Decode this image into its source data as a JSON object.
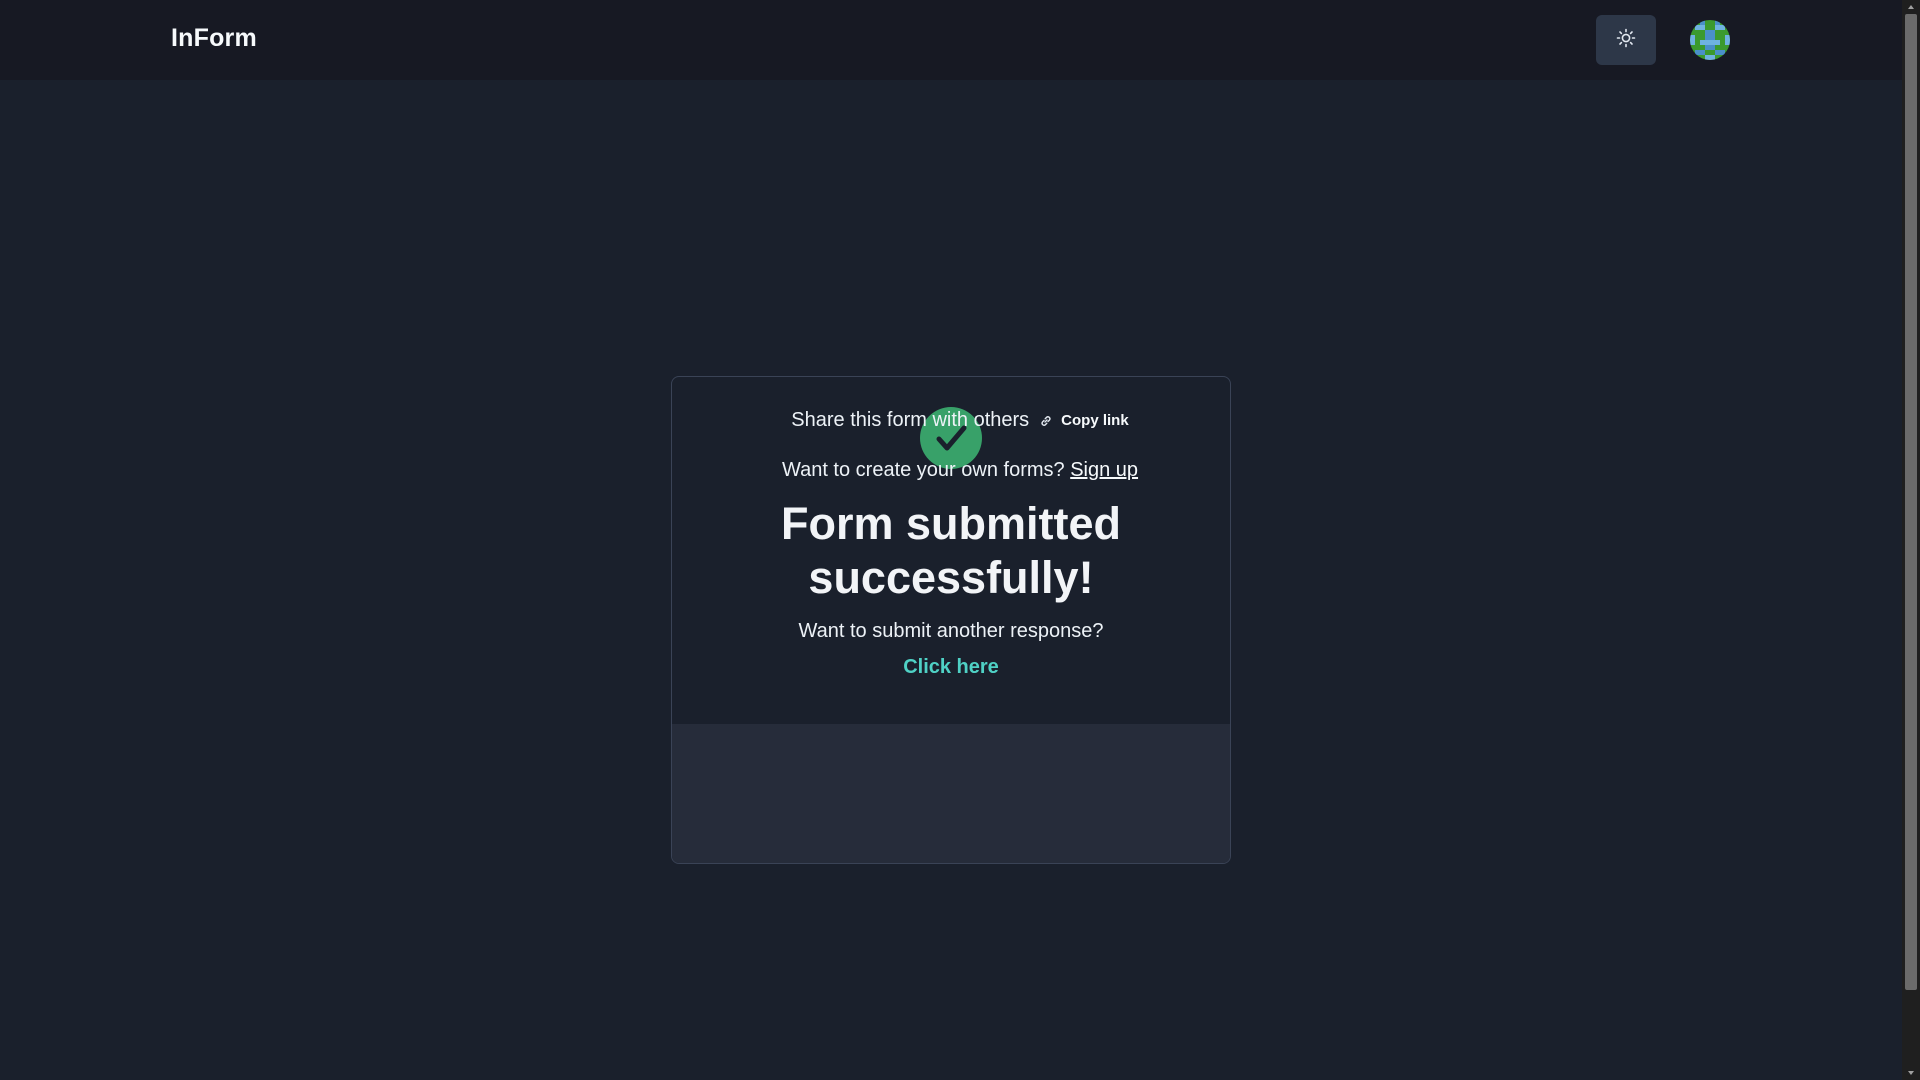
{
  "header": {
    "brand": "InForm",
    "theme_toggle_icon": "sun-icon",
    "avatar_icon": "avatar"
  },
  "card": {
    "status_icon": "check-circle-icon",
    "title_line1": "Form submitted",
    "title_line2": "successfully!",
    "subtitle": "Want to submit another response?",
    "click_here": "Click here",
    "share_text": "Share this form with others",
    "copy_link_icon": "link-icon",
    "copy_link": "Copy link",
    "signup_prefix": "Want to create your own forms?",
    "signup_link": "Sign up"
  },
  "colors": {
    "background": "#1a202c",
    "header_bg": "#171923",
    "success": "#38a169",
    "accent": "#4fd1c5",
    "card_footer_bg": "#262c3a"
  }
}
